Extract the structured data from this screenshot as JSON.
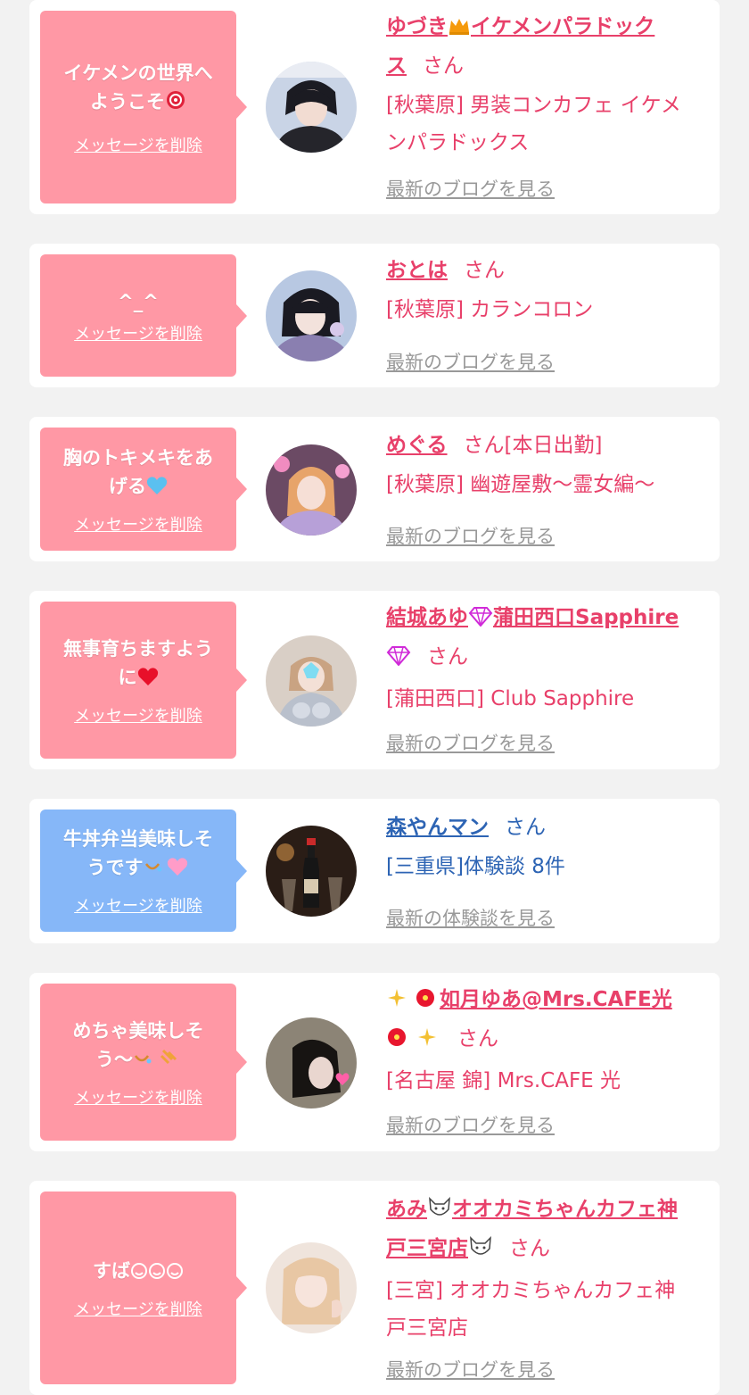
{
  "colors": {
    "pink_accent": "#e8406a",
    "blue_accent": "#2d64b4",
    "pink_bubble": "#ff98a5",
    "blue_bubble": "#86b7f8",
    "link_gray": "#999999"
  },
  "cards": [
    {
      "message_lines": [
        "イケメンの世界へ",
        "ようこそ"
      ],
      "message_icon": "rose-icon",
      "delete_label": "メッセージを削除",
      "name_lines": [
        "ゆづき",
        "イケメンパラドック",
        "ス"
      ],
      "name_icon": "crown-icon",
      "honorific": "さん",
      "shop_lines": [
        "[秋葉原] 男装コンカフェ イケメ",
        "ンパラドックス"
      ],
      "blog_link": "最新のブログを見る",
      "avatar_icon": "person-photo-icon"
    },
    {
      "message_lines": [
        "^_^"
      ],
      "delete_label": "メッセージを削除",
      "name_lines": [
        "おとは"
      ],
      "honorific": "さん",
      "shop_lines": [
        "[秋葉原] カランコロン"
      ],
      "blog_link": "最新のブログを見る",
      "avatar_icon": "person-photo-icon"
    },
    {
      "message_lines": [
        "胸のトキメキをあ",
        "げる"
      ],
      "message_icon": "blue-heart-icon",
      "delete_label": "メッセージを削除",
      "name_lines": [
        "めぐる"
      ],
      "honorific": "さん[本日出勤]",
      "shop_lines": [
        "[秋葉原] 幽遊屋敷〜霊女編〜"
      ],
      "blog_link": "最新のブログを見る",
      "avatar_icon": "person-photo-icon"
    },
    {
      "message_lines": [
        "無事育ちますよう",
        "に"
      ],
      "message_icon": "red-heart-icon",
      "delete_label": "メッセージを削除",
      "name_lines": [
        "結城あゆ",
        "蒲田西口Sapphire"
      ],
      "name_icon": "gem-icon",
      "honorific": "さん",
      "shop_lines": [
        "[蒲田西口] Club Sapphire"
      ],
      "blog_link": "最新のブログを見る",
      "avatar_icon": "person-photo-icon"
    },
    {
      "message_lines": [
        "牛丼弁当美味しそ",
        "うです"
      ],
      "message_icon": "drool-pink-heart-icon",
      "delete_label": "メッセージを削除",
      "name_lines": [
        "森やんマン"
      ],
      "honorific": "さん",
      "shop_lines": [
        "[三重県]体験談 8件"
      ],
      "blog_link": "最新の体験談を見る",
      "avatar_icon": "champagne-photo-icon"
    },
    {
      "message_lines": [
        "めちゃ美味しそ",
        "う〜"
      ],
      "message_icon": "drool-sparkle-icon",
      "delete_label": "メッセージを削除",
      "name_lines": [
        "如月ゆあ@Mrs.CAFE光"
      ],
      "name_icon": "sparkle-hibiscus-icon",
      "honorific": "さん",
      "shop_lines": [
        "[名古屋 錦] Mrs.CAFE 光"
      ],
      "blog_link": "最新のブログを見る",
      "avatar_icon": "person-photo-icon"
    },
    {
      "message_lines": [
        "すば"
      ],
      "message_icon": "smile-faces-icon",
      "delete_label": "メッセージを削除",
      "name_lines": [
        "あみ",
        "オオカミちゃんカフェ神",
        "戸三宮店"
      ],
      "name_icon": "wolf-icon",
      "honorific": "さん",
      "shop_lines": [
        "[三宮] オオカミちゃんカフェ神",
        "戸三宮店"
      ],
      "blog_link": "最新のブログを見る",
      "avatar_icon": "person-photo-icon"
    }
  ]
}
